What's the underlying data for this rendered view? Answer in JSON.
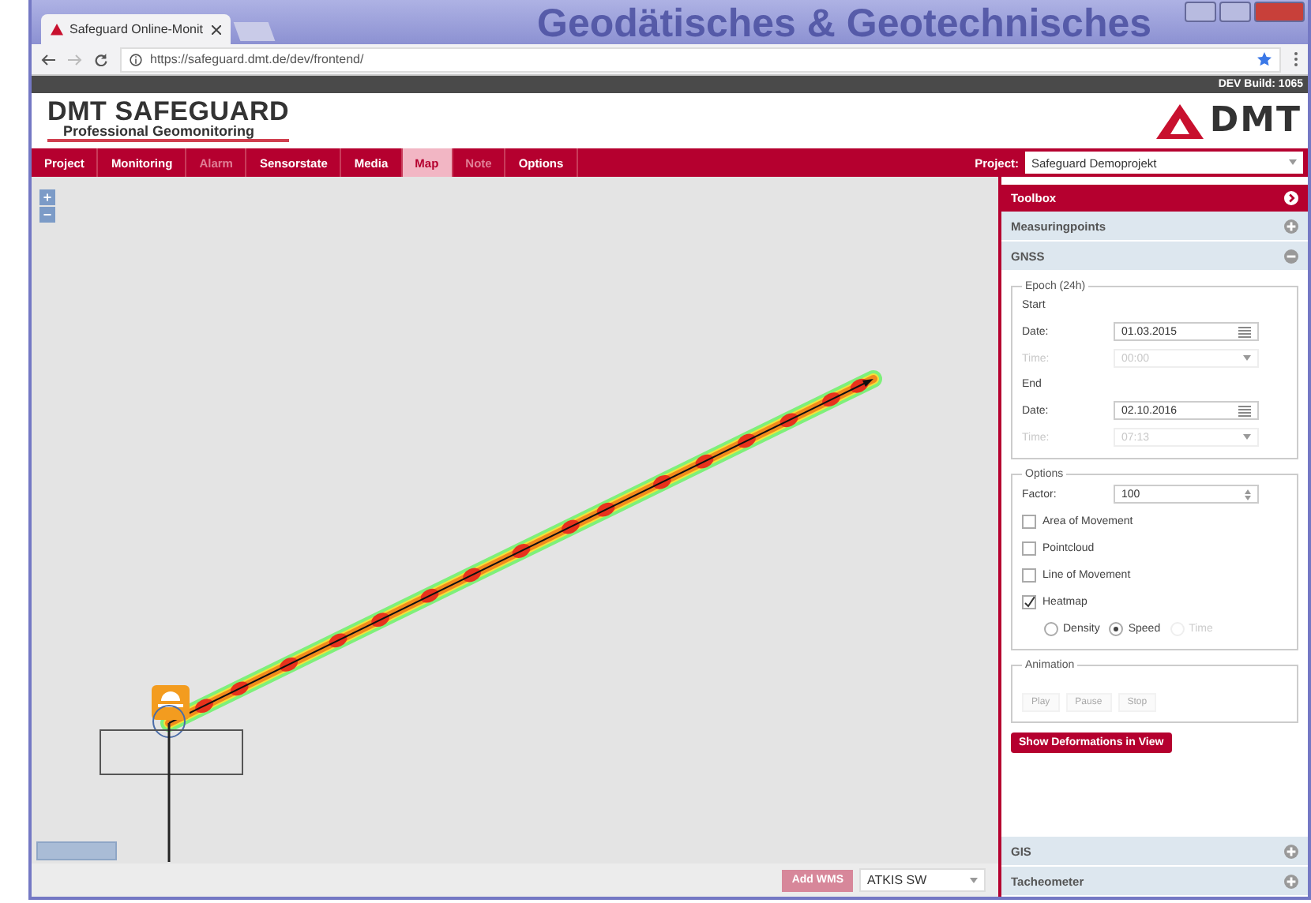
{
  "browser": {
    "tab_title": "Safeguard Online-Monit",
    "background_title": "Geodätisches & Geotechnisches",
    "address": "https://safeguard.dmt.de/dev/frontend/"
  },
  "build": "DEV Build: 1065",
  "brand": {
    "title": "DMT SAFEGUARD",
    "subtitle": "Professional Geomonitoring",
    "logo": "DMT"
  },
  "nav": [
    {
      "label": "Project",
      "selected": false,
      "disabled": false
    },
    {
      "label": "Monitoring",
      "selected": false,
      "disabled": false
    },
    {
      "label": "Alarm",
      "selected": false,
      "disabled": true
    },
    {
      "label": "Sensorstate",
      "selected": false,
      "disabled": false
    },
    {
      "label": "Media",
      "selected": false,
      "disabled": false
    },
    {
      "label": "Map",
      "selected": true,
      "disabled": false
    },
    {
      "label": "Note",
      "selected": false,
      "disabled": true
    },
    {
      "label": "Options",
      "selected": false,
      "disabled": false
    }
  ],
  "project": {
    "label": "Project:",
    "value": "Safeguard Demoprojekt"
  },
  "map": {
    "zoom_in": "+",
    "zoom_out": "−",
    "add_wms": "Add WMS",
    "layer": "ATKIS SW"
  },
  "toolbox": {
    "title": "Toolbox",
    "sections_top": [
      {
        "label": "Measuringpoints",
        "expanded": false
      },
      {
        "label": "GNSS",
        "expanded": true
      }
    ],
    "epoch": {
      "legend": "Epoch (24h)",
      "groups": [
        {
          "title": "Start",
          "date_label": "Date:",
          "date": "01.03.2015",
          "time_label": "Time:",
          "time": "00:00",
          "time_disabled": true
        },
        {
          "title": "End",
          "date_label": "Date:",
          "date": "02.10.2016",
          "time_label": "Time:",
          "time": "07:13",
          "time_disabled": true
        }
      ]
    },
    "options": {
      "legend": "Options",
      "factor_label": "Factor:",
      "factor": "100",
      "checks": [
        {
          "label": "Area of Movement",
          "checked": false
        },
        {
          "label": "Pointcloud",
          "checked": false
        },
        {
          "label": "Line of Movement",
          "checked": false
        },
        {
          "label": "Heatmap",
          "checked": true
        }
      ],
      "radios": [
        {
          "label": "Density",
          "selected": false,
          "disabled": false
        },
        {
          "label": "Speed",
          "selected": true,
          "disabled": false
        },
        {
          "label": "Time",
          "selected": false,
          "disabled": true
        }
      ]
    },
    "animation": {
      "legend": "Animation",
      "buttons": [
        {
          "label": "Play",
          "disabled": true
        },
        {
          "label": "Pause",
          "disabled": true
        },
        {
          "label": "Stop",
          "disabled": true
        }
      ]
    },
    "action": "Show Deformations in View",
    "sections_bottom": [
      {
        "label": "GIS",
        "expanded": false
      },
      {
        "label": "Tacheometer",
        "expanded": false
      }
    ]
  }
}
